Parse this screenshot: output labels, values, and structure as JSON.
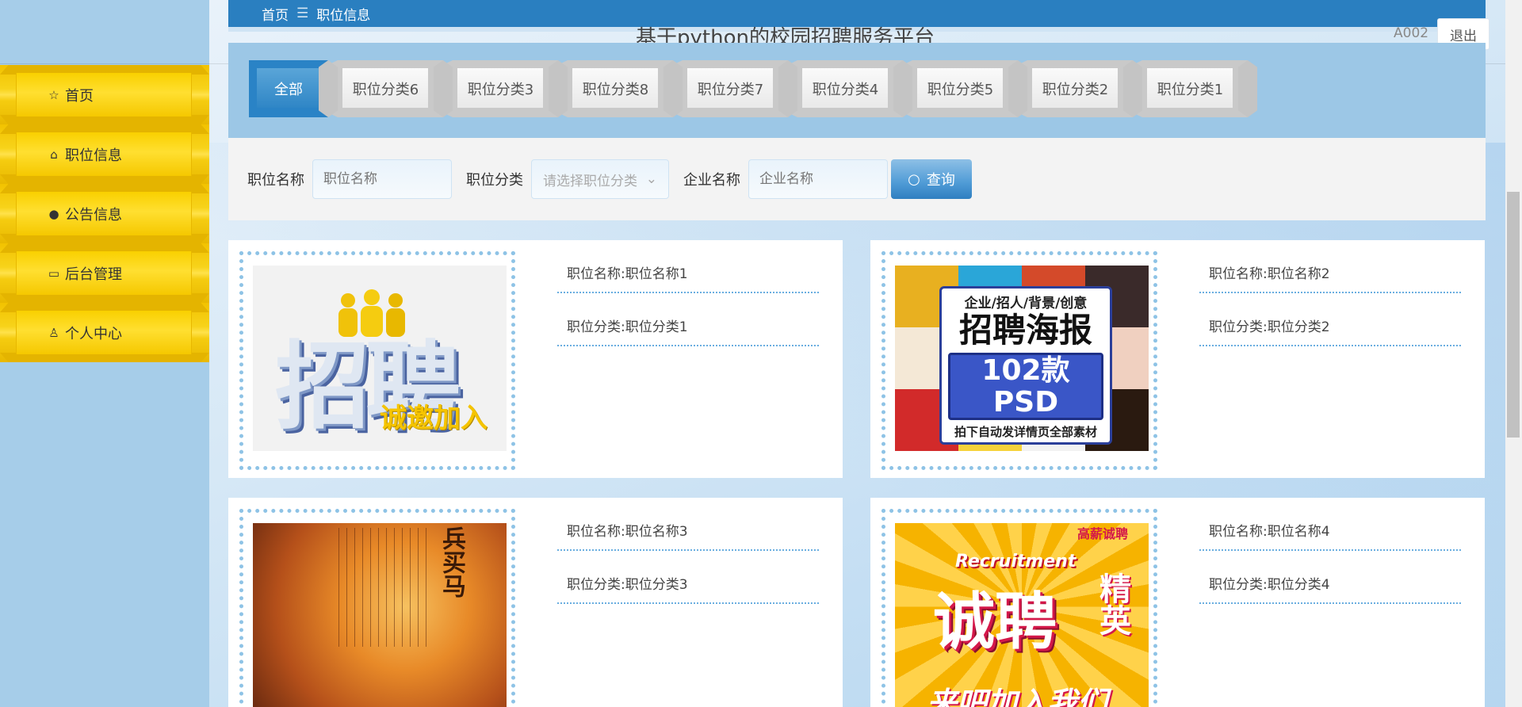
{
  "site": {
    "title": "基于python的校园招聘服务平台",
    "user": "A002",
    "logout_label": "退出"
  },
  "breadcrumb": {
    "home": "首页",
    "separator": "☰",
    "current": "职位信息"
  },
  "sidebar": {
    "items": [
      {
        "label": "首页",
        "icon": "star-icon",
        "glyph": "☆"
      },
      {
        "label": "职位信息",
        "icon": "bag-icon",
        "glyph": "⌂"
      },
      {
        "label": "公告信息",
        "icon": "alert-icon",
        "glyph": "●"
      },
      {
        "label": "后台管理",
        "icon": "briefcase-icon",
        "glyph": "▭"
      },
      {
        "label": "个人中心",
        "icon": "user-icon",
        "glyph": "♙"
      }
    ]
  },
  "categories": {
    "tabs": [
      "全部",
      "职位分类6",
      "职位分类3",
      "职位分类8",
      "职位分类7",
      "职位分类4",
      "职位分类5",
      "职位分类2",
      "职位分类1"
    ],
    "active_index": 0
  },
  "search": {
    "name_label": "职位名称",
    "name_placeholder": "职位名称",
    "category_label": "职位分类",
    "category_placeholder": "请选择职位分类",
    "company_label": "企业名称",
    "company_placeholder": "企业名称",
    "button_label": "查询"
  },
  "jobs": [
    {
      "name": "职位名称:职位名称1",
      "category": "职位分类:职位分类1",
      "img_text": {
        "big": "招聘",
        "sub": "诚邀加入"
      }
    },
    {
      "name": "职位名称:职位名称2",
      "category": "职位分类:职位分类2",
      "img_text": {
        "l1": "企业/招人/背景/创意",
        "l2": "招聘海报",
        "l3": "102款PSD",
        "l4": "拍下自动发详情页全部素材"
      }
    },
    {
      "name": "职位名称:职位名称3",
      "category": "职位分类:职位分类3",
      "img_text": {
        "title": "兵买马"
      }
    },
    {
      "name": "职位名称:职位名称4",
      "category": "职位分类:职位分类4",
      "img_text": {
        "top": "高薪诚聘",
        "rec": "Recruitment",
        "big": "诚聘",
        "side": "精英",
        "bot": "来吧加入我们"
      }
    }
  ],
  "colors": {
    "accent": "#2a7fc0",
    "sidebar_gold": "#f5c800",
    "dotted": "#8ec3e6"
  }
}
